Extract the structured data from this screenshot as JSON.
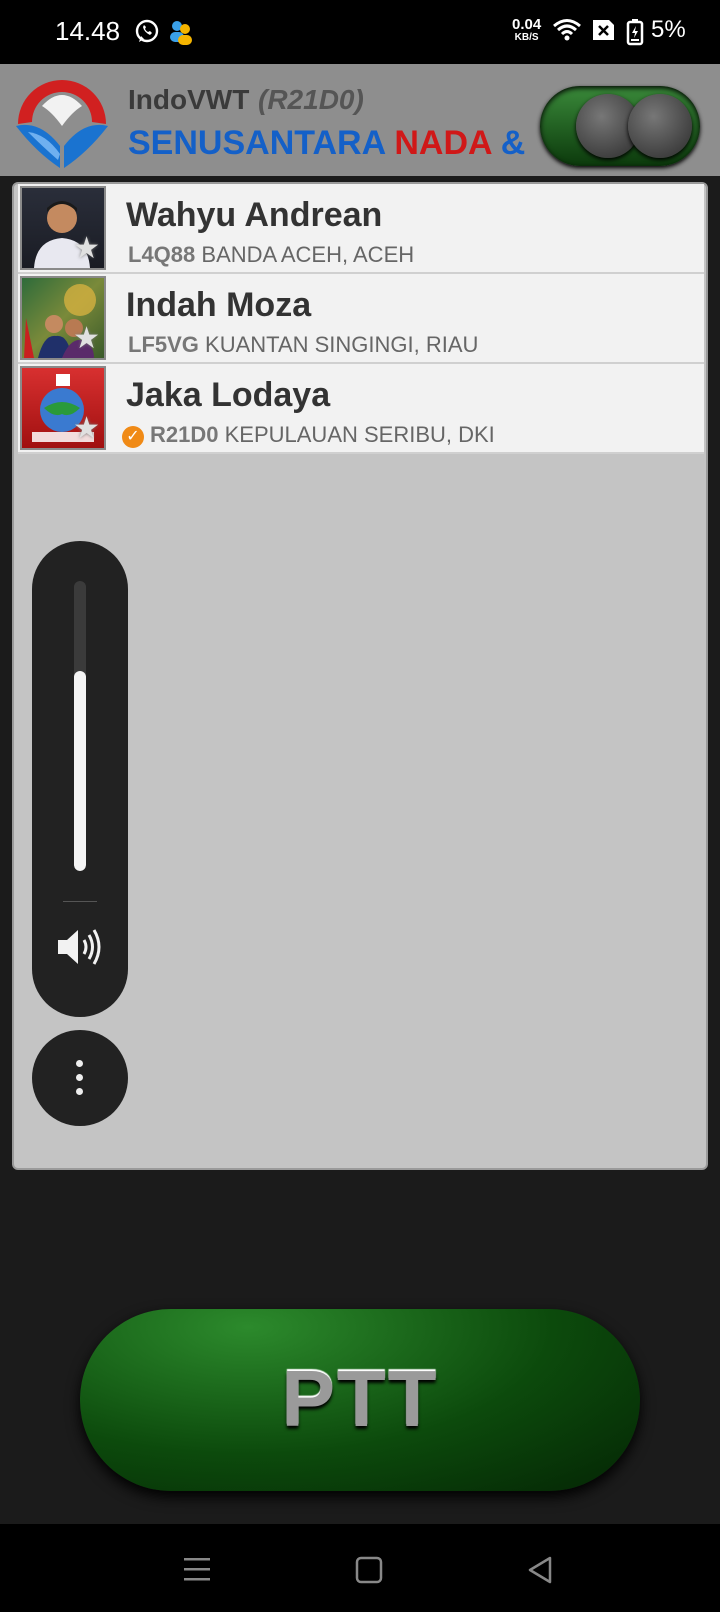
{
  "status_bar": {
    "time": "14.48",
    "net_speed_value": "0.04",
    "net_speed_unit": "KB/S",
    "battery": "5%",
    "icons": [
      "whatsapp-icon",
      "contacts-icon",
      "wifi-icon",
      "no-sim-icon",
      "battery-icon"
    ]
  },
  "header": {
    "app_title": "IndoVWT",
    "callsign": "(R21D0)",
    "marquee_blue": "SENUSANTARA ",
    "marquee_red": "NADA ",
    "marquee_end": "&",
    "power_toggle": "off"
  },
  "users": [
    {
      "name": "Wahyu Andrean",
      "callsign": "L4Q88",
      "location": "BANDA ACEH, ACEH",
      "verified": false
    },
    {
      "name": "Indah Moza",
      "callsign": "LF5VG",
      "location": "KUANTAN SINGINGI, RIAU",
      "verified": false
    },
    {
      "name": "Jaka Lodaya",
      "callsign": "R21D0",
      "location": "KEPULAUAN SERIBU, DKI",
      "verified": true
    }
  ],
  "volume": {
    "level": 0.69
  },
  "ptt": {
    "label": "PTT"
  },
  "colors": {
    "accent_green": "#0c4a0c",
    "marquee_blue": "#1460c8",
    "marquee_red": "#d01818",
    "verified": "#f08a16"
  }
}
